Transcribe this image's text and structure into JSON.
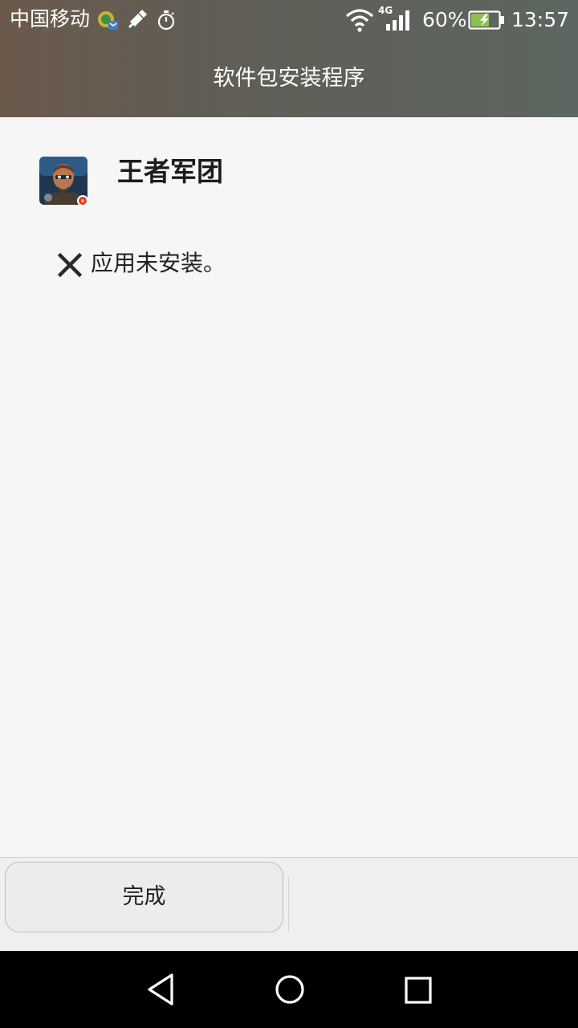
{
  "status_bar": {
    "carrier": "中国移动",
    "network": "4G",
    "battery_percent": "60%",
    "battery_level": 0.6,
    "battery_state": "charging",
    "time": "13:57",
    "icons": [
      "notification-app-icon",
      "usb-debug-icon",
      "stopwatch-icon",
      "wifi-icon",
      "cellular-signal-icon",
      "battery-charging-icon"
    ]
  },
  "title_bar": {
    "title": "软件包安装程序"
  },
  "app": {
    "name": "王者军团",
    "icon": "game-app-icon"
  },
  "result": {
    "icon": "close-x-icon",
    "message": "应用未安装。"
  },
  "actions": {
    "done_label": "完成"
  },
  "nav_bar": {
    "buttons": [
      "back-icon",
      "home-icon",
      "recents-icon"
    ]
  },
  "colors": {
    "header_gradient_start": "#6b5a4c",
    "header_gradient_end": "#5d6660",
    "background": "#f6f6f6",
    "action_bar": "#efefef",
    "battery_fill": "#8bc34a",
    "nav_bar": "#000000"
  }
}
